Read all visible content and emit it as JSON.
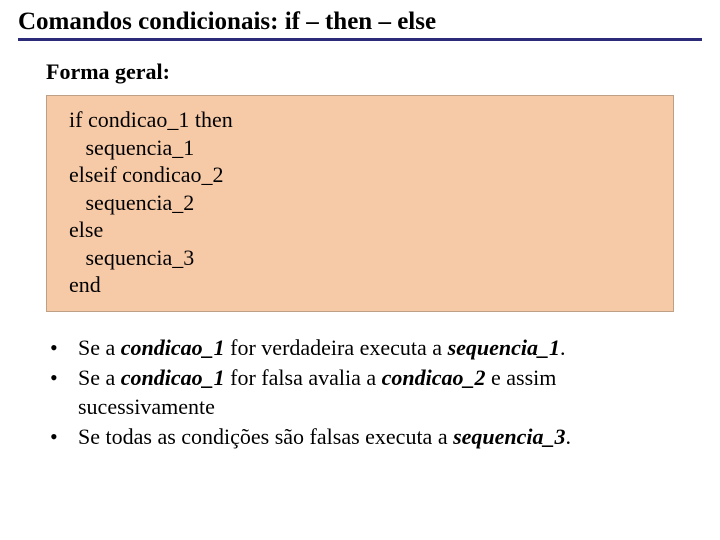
{
  "title": "Comandos condicionais: if – then – else",
  "subtitle": "Forma geral:",
  "code": {
    "l1": "if condicao_1 then",
    "l2": "   sequencia_1",
    "l3": "elseif condicao_2",
    "l4": "   sequencia_2",
    "l5": "else",
    "l6": "   sequencia_3",
    "l7": "end"
  },
  "bullets": {
    "b1_pre": " Se a ",
    "b1_em1": "condicao_1",
    "b1_mid": " for verdadeira executa a ",
    "b1_em2": "sequencia_1",
    "b1_post": ".",
    "b2_pre": " Se a ",
    "b2_em1": "condicao_1",
    "b2_mid": " for falsa avalia a ",
    "b2_em2": "condicao_2",
    "b2_post": " e assim",
    "b2_cont": "sucessivamente",
    "b3_pre": " Se todas as condições são falsas executa a ",
    "b3_em1": "sequencia_3",
    "b3_post": "."
  }
}
